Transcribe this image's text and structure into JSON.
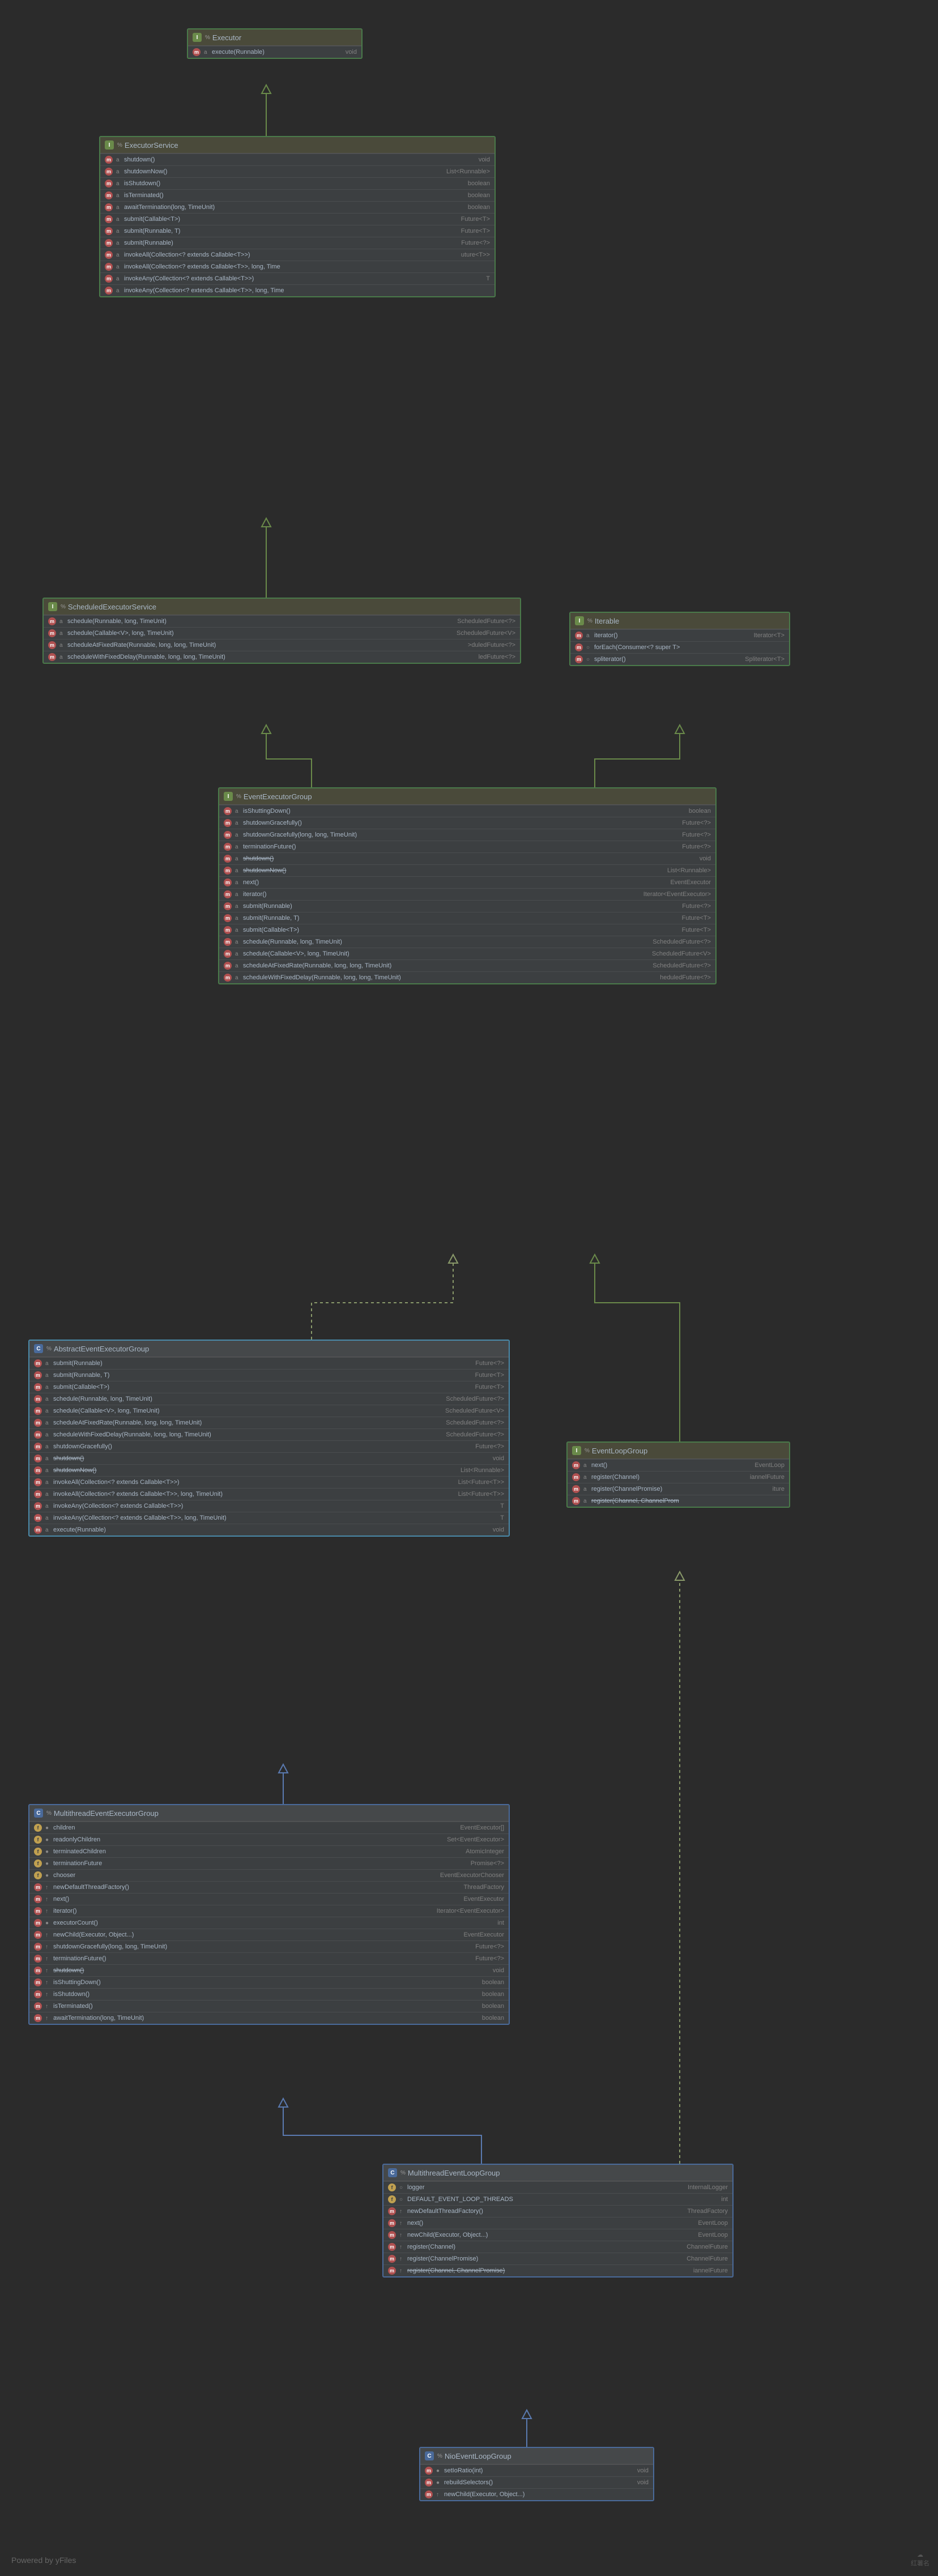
{
  "footer": "Powered by yFiles",
  "classes": {
    "executor": {
      "title": "Executor",
      "kind": "I",
      "members": [
        {
          "icon": "m",
          "mod": "a",
          "name": "execute(Runnable)",
          "ret": "void"
        }
      ]
    },
    "executorService": {
      "title": "ExecutorService",
      "kind": "I",
      "members": [
        {
          "icon": "m",
          "mod": "a",
          "name": "shutdown()",
          "ret": "void"
        },
        {
          "icon": "m",
          "mod": "a",
          "name": "shutdownNow()",
          "ret": "List<Runnable>"
        },
        {
          "icon": "m",
          "mod": "a",
          "name": "isShutdown()",
          "ret": "boolean"
        },
        {
          "icon": "m",
          "mod": "a",
          "name": "isTerminated()",
          "ret": "boolean"
        },
        {
          "icon": "m",
          "mod": "a",
          "name": "awaitTermination(long, TimeUnit)",
          "ret": "boolean"
        },
        {
          "icon": "m",
          "mod": "a",
          "name": "submit(Callable<T>)",
          "ret": "Future<T>"
        },
        {
          "icon": "m",
          "mod": "a",
          "name": "submit(Runnable, T)",
          "ret": "Future<T>"
        },
        {
          "icon": "m",
          "mod": "a",
          "name": "submit(Runnable)",
          "ret": "Future<?>"
        },
        {
          "icon": "m",
          "mod": "a",
          "name": "invokeAll(Collection<? extends Callable<T>>)",
          "ret": "uture<T>>"
        },
        {
          "icon": "m",
          "mod": "a",
          "name": "invokeAll(Collection<? extends Callable<T>>, long, Time",
          "ret": ""
        },
        {
          "icon": "m",
          "mod": "a",
          "name": "invokeAny(Collection<? extends Callable<T>>)",
          "ret": "T"
        },
        {
          "icon": "m",
          "mod": "a",
          "name": "invokeAny(Collection<? extends Callable<T>>, long, Time",
          "ret": ""
        }
      ]
    },
    "scheduledExecutorService": {
      "title": "ScheduledExecutorService",
      "kind": "I",
      "members": [
        {
          "icon": "m",
          "mod": "a",
          "name": "schedule(Runnable, long, TimeUnit)",
          "ret": "ScheduledFuture<?>"
        },
        {
          "icon": "m",
          "mod": "a",
          "name": "schedule(Callable<V>, long, TimeUnit)",
          "ret": "ScheduledFuture<V>"
        },
        {
          "icon": "m",
          "mod": "a",
          "name": "scheduleAtFixedRate(Runnable, long, long, TimeUnit)",
          "ret": ">duledFuture<?>"
        },
        {
          "icon": "m",
          "mod": "a",
          "name": "scheduleWithFixedDelay(Runnable, long, long, TimeUnit)",
          "ret": "ledFuture<?>"
        }
      ]
    },
    "iterable": {
      "title": "Iterable",
      "kind": "I",
      "members": [
        {
          "icon": "m",
          "mod": "a",
          "name": "iterator()",
          "ret": "Iterator<T>"
        },
        {
          "icon": "m",
          "mod": "○",
          "name": "forEach(Consumer<? super T>",
          "ret": ""
        },
        {
          "icon": "m",
          "mod": "○",
          "name": "spliterator()",
          "ret": "Spliterator<T>"
        }
      ]
    },
    "eventExecutorGroup": {
      "title": "EventExecutorGroup",
      "kind": "I",
      "members": [
        {
          "icon": "m",
          "mod": "a",
          "name": "isShuttingDown()",
          "ret": "boolean"
        },
        {
          "icon": "m",
          "mod": "a",
          "name": "shutdownGracefully()",
          "ret": "Future<?>"
        },
        {
          "icon": "m",
          "mod": "a",
          "name": "shutdownGracefully(long, long, TimeUnit)",
          "ret": "Future<?>"
        },
        {
          "icon": "m",
          "mod": "a",
          "name": "terminationFuture()",
          "ret": "Future<?>"
        },
        {
          "icon": "m",
          "mod": "a",
          "name": "shutdown()",
          "ret": "void",
          "strike": true
        },
        {
          "icon": "m",
          "mod": "a",
          "name": "shutdownNow()",
          "ret": "List<Runnable>",
          "strike": true
        },
        {
          "icon": "m",
          "mod": "a",
          "name": "next()",
          "ret": "EventExecutor"
        },
        {
          "icon": "m",
          "mod": "a",
          "name": "iterator()",
          "ret": "Iterator<EventExecutor>"
        },
        {
          "icon": "m",
          "mod": "a",
          "name": "submit(Runnable)",
          "ret": "Future<?>"
        },
        {
          "icon": "m",
          "mod": "a",
          "name": "submit(Runnable, T)",
          "ret": "Future<T>"
        },
        {
          "icon": "m",
          "mod": "a",
          "name": "submit(Callable<T>)",
          "ret": "Future<T>"
        },
        {
          "icon": "m",
          "mod": "a",
          "name": "schedule(Runnable, long, TimeUnit)",
          "ret": "ScheduledFuture<?>"
        },
        {
          "icon": "m",
          "mod": "a",
          "name": "schedule(Callable<V>, long, TimeUnit)",
          "ret": "ScheduledFuture<V>"
        },
        {
          "icon": "m",
          "mod": "a",
          "name": "scheduleAtFixedRate(Runnable, long, long, TimeUnit)",
          "ret": "ScheduledFuture<?>"
        },
        {
          "icon": "m",
          "mod": "a",
          "name": "scheduleWithFixedDelay(Runnable, long, long, TimeUnit)",
          "ret": "heduledFuture<?>"
        }
      ]
    },
    "abstractEventExecutorGroup": {
      "title": "AbstractEventExecutorGroup",
      "kind": "C",
      "members": [
        {
          "icon": "m",
          "mod": "a",
          "name": "submit(Runnable)",
          "ret": "Future<?>"
        },
        {
          "icon": "m",
          "mod": "a",
          "name": "submit(Runnable, T)",
          "ret": "Future<T>"
        },
        {
          "icon": "m",
          "mod": "a",
          "name": "submit(Callable<T>)",
          "ret": "Future<T>"
        },
        {
          "icon": "m",
          "mod": "a",
          "name": "schedule(Runnable, long, TimeUnit)",
          "ret": "ScheduledFuture<?>"
        },
        {
          "icon": "m",
          "mod": "a",
          "name": "schedule(Callable<V>, long, TimeUnit)",
          "ret": "ScheduledFuture<V>"
        },
        {
          "icon": "m",
          "mod": "a",
          "name": "scheduleAtFixedRate(Runnable, long, long, TimeUnit)",
          "ret": "ScheduledFuture<?>"
        },
        {
          "icon": "m",
          "mod": "a",
          "name": "scheduleWithFixedDelay(Runnable, long, long, TimeUnit)",
          "ret": "ScheduledFuture<?>"
        },
        {
          "icon": "m",
          "mod": "a",
          "name": "shutdownGracefully()",
          "ret": "Future<?>"
        },
        {
          "icon": "m",
          "mod": "a",
          "name": "shutdown()",
          "ret": "void",
          "strike": true
        },
        {
          "icon": "m",
          "mod": "a",
          "name": "shutdownNow()",
          "ret": "List<Runnable>",
          "strike": true
        },
        {
          "icon": "m",
          "mod": "a",
          "name": "invokeAll(Collection<? extends Callable<T>>)",
          "ret": "List<Future<T>>"
        },
        {
          "icon": "m",
          "mod": "a",
          "name": "invokeAll(Collection<? extends Callable<T>>, long, TimeUnit)",
          "ret": "List<Future<T>>"
        },
        {
          "icon": "m",
          "mod": "a",
          "name": "invokeAny(Collection<? extends Callable<T>>)",
          "ret": "T"
        },
        {
          "icon": "m",
          "mod": "a",
          "name": "invokeAny(Collection<? extends Callable<T>>, long, TimeUnit)",
          "ret": "T"
        },
        {
          "icon": "m",
          "mod": "a",
          "name": "execute(Runnable)",
          "ret": "void"
        }
      ]
    },
    "eventLoopGroup": {
      "title": "EventLoopGroup",
      "kind": "I",
      "members": [
        {
          "icon": "m",
          "mod": "a",
          "name": "next()",
          "ret": "EventLoop"
        },
        {
          "icon": "m",
          "mod": "a",
          "name": "register(Channel)",
          "ret": "iannelFuture"
        },
        {
          "icon": "m",
          "mod": "a",
          "name": "register(ChannelPromise)",
          "ret": "iture"
        },
        {
          "icon": "m",
          "mod": "a",
          "name": "register(Channel, ChannelProm",
          "ret": "",
          "strike": true
        }
      ]
    },
    "multithreadEventExecutorGroup": {
      "title": "MultithreadEventExecutorGroup",
      "kind": "C",
      "members": [
        {
          "icon": "f",
          "mod": "●",
          "name": "children",
          "ret": "EventExecutor[]"
        },
        {
          "icon": "f",
          "mod": "●",
          "name": "readonlyChildren",
          "ret": "Set<EventExecutor>"
        },
        {
          "icon": "f",
          "mod": "●",
          "name": "terminatedChildren",
          "ret": "AtomicInteger"
        },
        {
          "icon": "f",
          "mod": "●",
          "name": "terminationFuture",
          "ret": "Promise<?>"
        },
        {
          "icon": "f",
          "mod": "●",
          "name": "chooser",
          "ret": "EventExecutorChooser"
        },
        {
          "icon": "m",
          "mod": "↑",
          "name": "newDefaultThreadFactory()",
          "ret": "ThreadFactory"
        },
        {
          "icon": "m",
          "mod": "↑",
          "name": "next()",
          "ret": "EventExecutor"
        },
        {
          "icon": "m",
          "mod": "↑",
          "name": "iterator()",
          "ret": "Iterator<EventExecutor>"
        },
        {
          "icon": "m",
          "mod": "●",
          "name": "executorCount()",
          "ret": "int"
        },
        {
          "icon": "m",
          "mod": "↑",
          "name": "newChild(Executor, Object...)",
          "ret": "EventExecutor"
        },
        {
          "icon": "m",
          "mod": "↑",
          "name": "shutdownGracefully(long, long, TimeUnit)",
          "ret": "Future<?>"
        },
        {
          "icon": "m",
          "mod": "↑",
          "name": "terminationFuture()",
          "ret": "Future<?>"
        },
        {
          "icon": "m",
          "mod": "↑",
          "name": "shutdown()",
          "ret": "void",
          "strike": true
        },
        {
          "icon": "m",
          "mod": "↑",
          "name": "isShuttingDown()",
          "ret": "boolean"
        },
        {
          "icon": "m",
          "mod": "↑",
          "name": "isShutdown()",
          "ret": "boolean"
        },
        {
          "icon": "m",
          "mod": "↑",
          "name": "isTerminated()",
          "ret": "boolean"
        },
        {
          "icon": "m",
          "mod": "↑",
          "name": "awaitTermination(long, TimeUnit)",
          "ret": "boolean"
        }
      ]
    },
    "multithreadEventLoopGroup": {
      "title": "MultithreadEventLoopGroup",
      "kind": "C",
      "members": [
        {
          "icon": "f",
          "mod": "○",
          "name": "logger",
          "ret": "InternalLogger"
        },
        {
          "icon": "f",
          "mod": "○",
          "name": "DEFAULT_EVENT_LOOP_THREADS",
          "ret": "int"
        },
        {
          "icon": "m",
          "mod": "↑",
          "name": "newDefaultThreadFactory()",
          "ret": "ThreadFactory"
        },
        {
          "icon": "m",
          "mod": "↑",
          "name": "next()",
          "ret": "EventLoop"
        },
        {
          "icon": "m",
          "mod": "↑",
          "name": "newChild(Executor, Object...)",
          "ret": "EventLoop"
        },
        {
          "icon": "m",
          "mod": "↑",
          "name": "register(Channel)",
          "ret": "ChannelFuture"
        },
        {
          "icon": "m",
          "mod": "↑",
          "name": "register(ChannelPromise)",
          "ret": "ChannelFuture"
        },
        {
          "icon": "m",
          "mod": "↑",
          "name": "register(Channel, ChannelPromise)",
          "ret": "iannelFuture",
          "strike": true
        }
      ]
    },
    "nioEventLoopGroup": {
      "title": "NioEventLoopGroup",
      "kind": "C",
      "members": [
        {
          "icon": "m",
          "mod": "●",
          "name": "setIoRatio(int)",
          "ret": "void"
        },
        {
          "icon": "m",
          "mod": "●",
          "name": "rebuildSelectors()",
          "ret": "void"
        },
        {
          "icon": "m",
          "mod": "↑",
          "name": "newChild(Executor, Object...)",
          "ret": ""
        }
      ]
    }
  }
}
